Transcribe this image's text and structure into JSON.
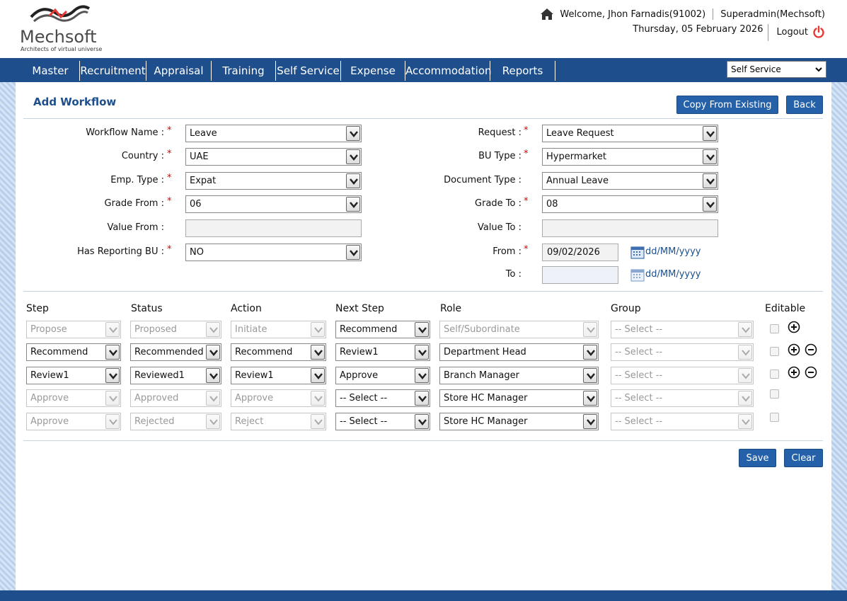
{
  "header": {
    "logo_text": "Mechsoft",
    "logo_tagline": "Architects of virtual universe",
    "welcome": "Welcome, Jhon Farnadis(91002)",
    "role": "Superadmin(Mechsoft)",
    "date": "Thursday, 05 February 2026",
    "logout": "Logout"
  },
  "menu": {
    "items": [
      {
        "label": "Master"
      },
      {
        "label": "Recruitment"
      },
      {
        "label": "Appraisal"
      },
      {
        "label": "Training"
      },
      {
        "label": "Self Service"
      },
      {
        "label": "Expense"
      },
      {
        "label": "Accommodation"
      },
      {
        "label": "Reports"
      }
    ],
    "module_select": "Self Service"
  },
  "page": {
    "title": "Add Workflow",
    "copy_button": "Copy From Existing",
    "back_button": "Back",
    "save_button": "Save",
    "clear_button": "Clear"
  },
  "form": {
    "workflow_name": {
      "label": "Workflow Name :",
      "value": "Leave"
    },
    "request": {
      "label": "Request :",
      "value": "Leave Request"
    },
    "country": {
      "label": "Country :",
      "value": "UAE"
    },
    "bu_type": {
      "label": "BU Type :",
      "value": "Hypermarket"
    },
    "emp_type": {
      "label": "Emp. Type :",
      "value": "Expat"
    },
    "document_type": {
      "label": "Document Type :",
      "value": "Annual Leave"
    },
    "grade_from": {
      "label": "Grade From :",
      "value": "06"
    },
    "grade_to": {
      "label": "Grade To :",
      "value": "08"
    },
    "value_from": {
      "label": "Value From :",
      "value": ""
    },
    "value_to": {
      "label": "Value To :",
      "value": ""
    },
    "has_reporting_bu": {
      "label": "Has Reporting BU :",
      "value": "NO"
    },
    "from": {
      "label": "From :",
      "value": "09/02/2026",
      "format": "dd/MM/yyyy"
    },
    "to": {
      "label": "To :",
      "value": "",
      "format": "dd/MM/yyyy"
    }
  },
  "steps": {
    "headers": {
      "step": "Step",
      "status": "Status",
      "action": "Action",
      "next_step": "Next Step",
      "role": "Role",
      "group": "Group",
      "editable": "Editable"
    },
    "rows": [
      {
        "step": "Propose",
        "status": "Proposed",
        "action": "Initiate",
        "next_step": "Recommend",
        "role": "Self/Subordinate",
        "group": "-- Select --"
      },
      {
        "step": "Recommend",
        "status": "Recommended",
        "action": "Recommend",
        "next_step": "Review1",
        "role": "Department Head",
        "group": "-- Select --"
      },
      {
        "step": "Review1",
        "status": "Reviewed1",
        "action": "Review1",
        "next_step": "Approve",
        "role": "Branch Manager",
        "group": "-- Select --"
      },
      {
        "step": "Approve",
        "status": "Approved",
        "action": "Approve",
        "next_step": "-- Select --",
        "role": "Store HC Manager",
        "group": "-- Select --"
      },
      {
        "step": "Approve",
        "status": "Rejected",
        "action": "Reject",
        "next_step": "-- Select --",
        "role": "Store HC Manager",
        "group": "-- Select --"
      }
    ]
  },
  "colors": {
    "brand": "#1f4e8c",
    "button": "#2461a8",
    "required": "#dd0000",
    "power": "#e53935"
  }
}
